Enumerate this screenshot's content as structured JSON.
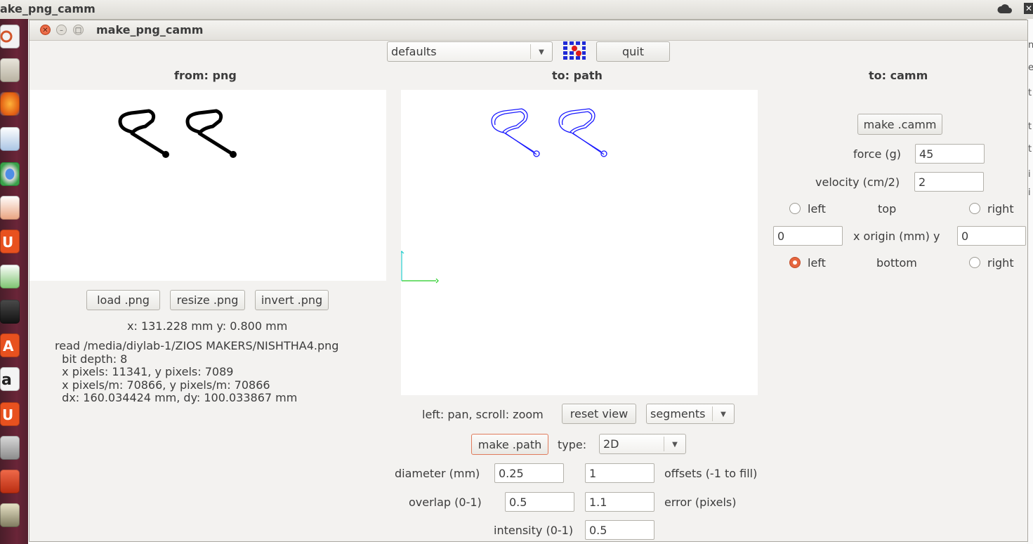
{
  "system": {
    "title": "ake_png_camm",
    "close_glyph": "✕"
  },
  "window": {
    "title": "make_png_camm",
    "close_glyph": "✕",
    "min_glyph": "–",
    "max_glyph": "□"
  },
  "toolbar": {
    "preset": "defaults",
    "quit_label": "quit"
  },
  "from_png": {
    "header": "from: png",
    "load_label": "load .png",
    "resize_label": "resize .png",
    "invert_label": "invert .png",
    "coords": "x: 131.228 mm  y: 0.800 mm",
    "info": "read /media/diylab-1/ZIOS MAKERS/NISHTHA4.png\n  bit depth: 8\n  x pixels: 11341, y pixels: 7089\n  x pixels/m: 70866, y pixels/m: 70866\n  dx: 160.034424 mm, dy: 100.033867 mm"
  },
  "to_path": {
    "header": "to: path",
    "view_hint": "left: pan, scroll: zoom",
    "reset_view_label": "reset view",
    "view_mode": "segments",
    "make_path_label": "make .path",
    "type_label": "type:",
    "type_value": "2D",
    "diameter_label": "diameter (mm)",
    "diameter_value": "0.25",
    "offsets_value": "1",
    "offsets_label": "offsets (-1 to fill)",
    "overlap_label": "overlap (0-1)",
    "overlap_value": "0.5",
    "error_value": "1.1",
    "error_label": "error (pixels)",
    "intensity_label": "intensity (0-1)",
    "intensity_value": "0.5"
  },
  "to_camm": {
    "header": "to: camm",
    "make_camm_label": "make .camm",
    "force_label": "force (g)",
    "force_value": "45",
    "velocity_label": "velocity (cm/2)",
    "velocity_value": "2",
    "top_left_label": "left",
    "top_label": "top",
    "top_right_label": "right",
    "x_origin_value": "0",
    "origin_label": "x  origin (mm)  y",
    "y_origin_value": "0",
    "bottom_left_label": "left",
    "bottom_label": "bottom",
    "bottom_right_label": "right",
    "origin_corner": "bottom-left"
  },
  "colors": {
    "path_stroke": "#1a1aff",
    "axis_x": "#22cc22",
    "axis_y": "#22cccc",
    "radio_selected": "#e6663f",
    "launcher": "#6a2538"
  }
}
